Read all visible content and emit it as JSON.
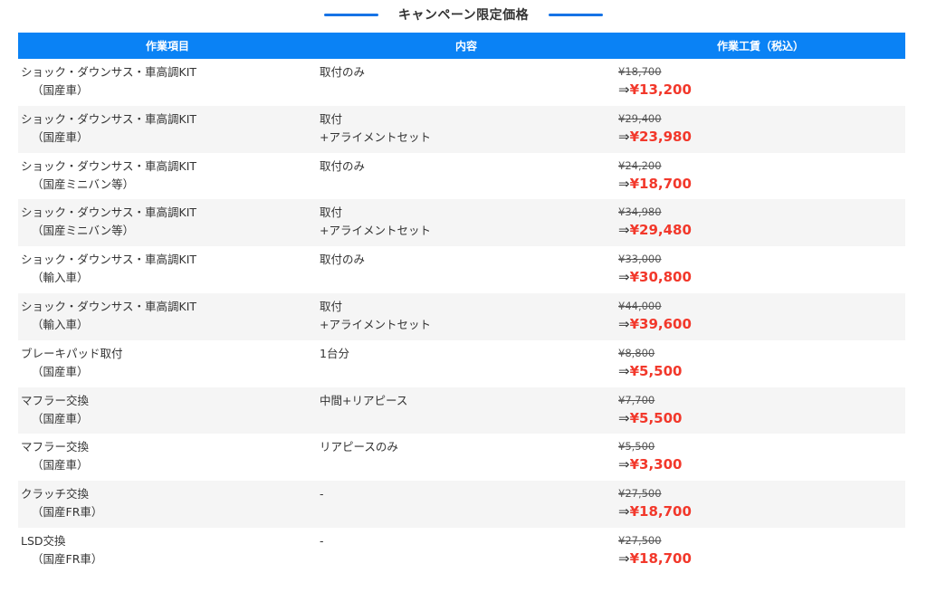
{
  "heading": "キャンペーン限定価格",
  "columns": [
    "作業項目",
    "内容",
    "作業工賃（税込）"
  ],
  "arrow": "⇒",
  "rows": [
    {
      "name": "ショック・ダウンサス・車高調KIT",
      "sub": "（国産車）",
      "content": [
        "取付のみ"
      ],
      "old_price": "¥18,700",
      "new_price": "¥13,200"
    },
    {
      "name": "ショック・ダウンサス・車高調KIT",
      "sub": "（国産車）",
      "content": [
        "取付",
        "+アライメントセット"
      ],
      "old_price": "¥29,400",
      "new_price": "¥23,980"
    },
    {
      "name": "ショック・ダウンサス・車高調KIT",
      "sub": "（国産ミニバン等）",
      "content": [
        "取付のみ"
      ],
      "old_price": "¥24,200",
      "new_price": "¥18,700"
    },
    {
      "name": "ショック・ダウンサス・車高調KIT",
      "sub": "（国産ミニバン等）",
      "content": [
        "取付",
        "+アライメントセット"
      ],
      "old_price": "¥34,980",
      "new_price": "¥29,480"
    },
    {
      "name": "ショック・ダウンサス・車高調KIT",
      "sub": "（輸入車）",
      "content": [
        "取付のみ"
      ],
      "old_price": "¥33,000",
      "new_price": "¥30,800"
    },
    {
      "name": "ショック・ダウンサス・車高調KIT",
      "sub": "（輸入車）",
      "content": [
        "取付",
        "+アライメントセット"
      ],
      "old_price": "¥44,000",
      "new_price": "¥39,600"
    },
    {
      "name": "ブレーキパッド取付",
      "sub": "（国産車）",
      "content": [
        "1台分"
      ],
      "old_price": "¥8,800",
      "new_price": "¥5,500"
    },
    {
      "name": "マフラー交換",
      "sub": "（国産車）",
      "content": [
        "中間+リアピース"
      ],
      "old_price": "¥7,700",
      "new_price": "¥5,500"
    },
    {
      "name": "マフラー交換",
      "sub": "（国産車）",
      "content": [
        "リアピースのみ"
      ],
      "old_price": "¥5,500",
      "new_price": "¥3,300"
    },
    {
      "name": "クラッチ交換",
      "sub": "（国産FR車）",
      "content": [
        "-"
      ],
      "old_price": "¥27,500",
      "new_price": "¥18,700"
    },
    {
      "name": "LSD交換",
      "sub": "（国産FR車）",
      "content": [
        "-"
      ],
      "old_price": "¥27,500",
      "new_price": "¥18,700"
    }
  ]
}
